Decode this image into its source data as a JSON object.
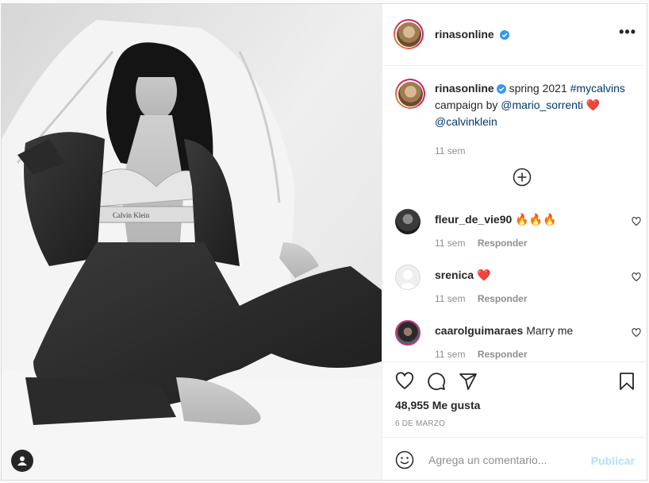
{
  "post": {
    "username": "rinasonline",
    "caption": {
      "username": "rinasonline",
      "text_1": "spring 2021",
      "hashtag": "#mycalvins",
      "text_2": "campaign by",
      "mention_1": "@mario_sorrenti",
      "emoji": "❤️",
      "mention_2": "@calvinklein",
      "time": "11 sem"
    },
    "comments": [
      {
        "username": "fleur_de_vie90",
        "text": "🔥🔥🔥",
        "time": "11 sem",
        "reply_label": "Responder"
      },
      {
        "username": "srenica",
        "text": "❤️",
        "time": "11 sem",
        "reply_label": "Responder"
      },
      {
        "username": "caarolguimaraes",
        "text": "Marry me",
        "time": "11 sem",
        "reply_label": "Responder"
      }
    ],
    "likes": "48,955 Me gusta",
    "date": "6 DE MARZO",
    "comment_input": {
      "placeholder": "Agrega un comentario...",
      "value": ""
    },
    "publish_label": "Publicar",
    "more_label": "•••"
  },
  "image_text": {
    "waistband": "Calvin Klein"
  },
  "colors": {
    "verified": "#3897f0",
    "link": "#00376b",
    "muted": "#8e8e8e",
    "publish_disabled": "#b2dffc"
  }
}
